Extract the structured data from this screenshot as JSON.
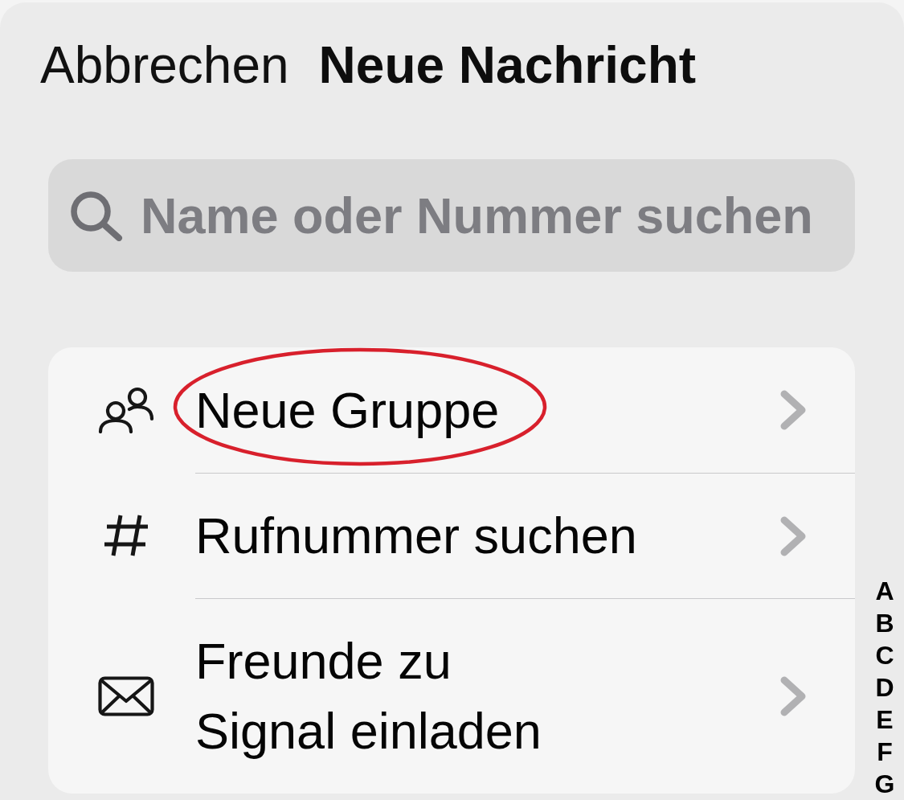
{
  "header": {
    "cancel": "Abbrechen",
    "title": "Neue Nachricht"
  },
  "search": {
    "placeholder": "Name oder Nummer suchen"
  },
  "items": [
    {
      "kind": "group",
      "label": "Neue Gruppe",
      "highlighted": true
    },
    {
      "kind": "number",
      "label": "Rufnummer suchen",
      "highlighted": false
    },
    {
      "kind": "invite",
      "label": "Freunde zu\nSignal einladen",
      "highlighted": false
    }
  ],
  "index": [
    "A",
    "B",
    "C",
    "D",
    "E",
    "F",
    "G"
  ]
}
